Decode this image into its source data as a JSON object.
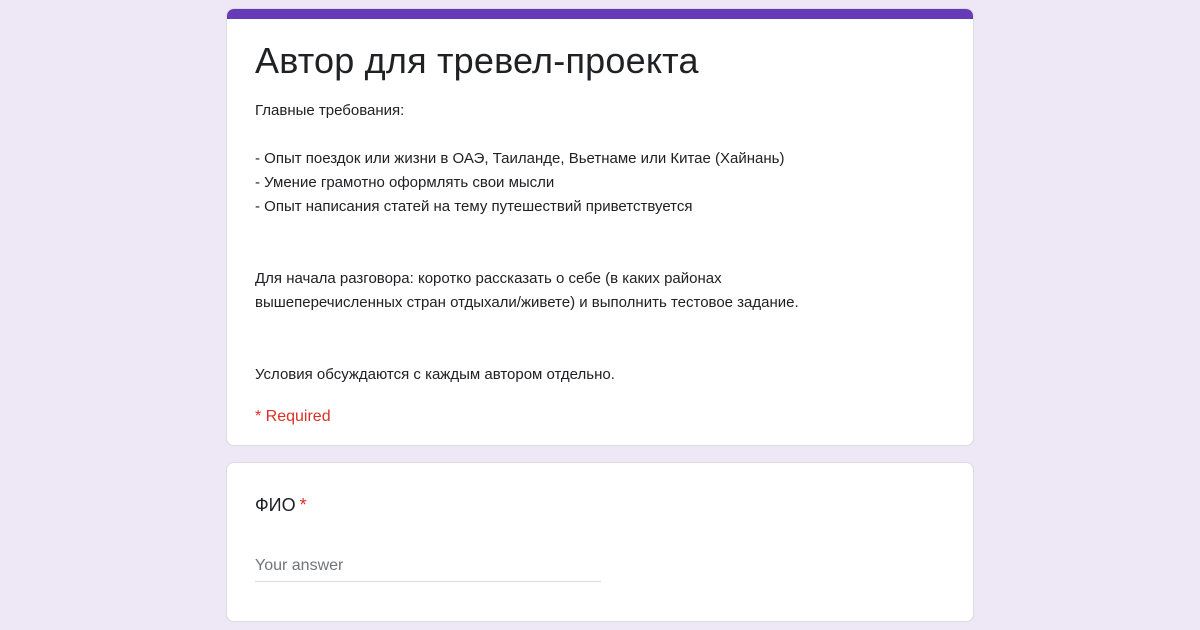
{
  "form": {
    "title": "Автор для тревел-проекта",
    "description": "Главные требования:\n\n- Опыт поездок или жизни в ОАЭ, Таиланде, Вьетнаме или Китае (Хайнань)\n- Умение грамотно оформлять свои мысли\n- Опыт написания статей на тему путешествий приветствуется\n\n\nДля начала разговора: коротко рассказать о себе (в каких районах\nвышеперечисленных стран отдыхали/живете) и выполнить тестовое задание.\n\n\nУсловия обсуждаются с каждым автором отдельно.",
    "required_note": "* Required",
    "accent_color": "#673ab7",
    "background_color": "#ede7f6"
  },
  "question": {
    "title": "ФИО",
    "required_marker": "*",
    "answer_placeholder": "Your answer",
    "answer_value": ""
  }
}
